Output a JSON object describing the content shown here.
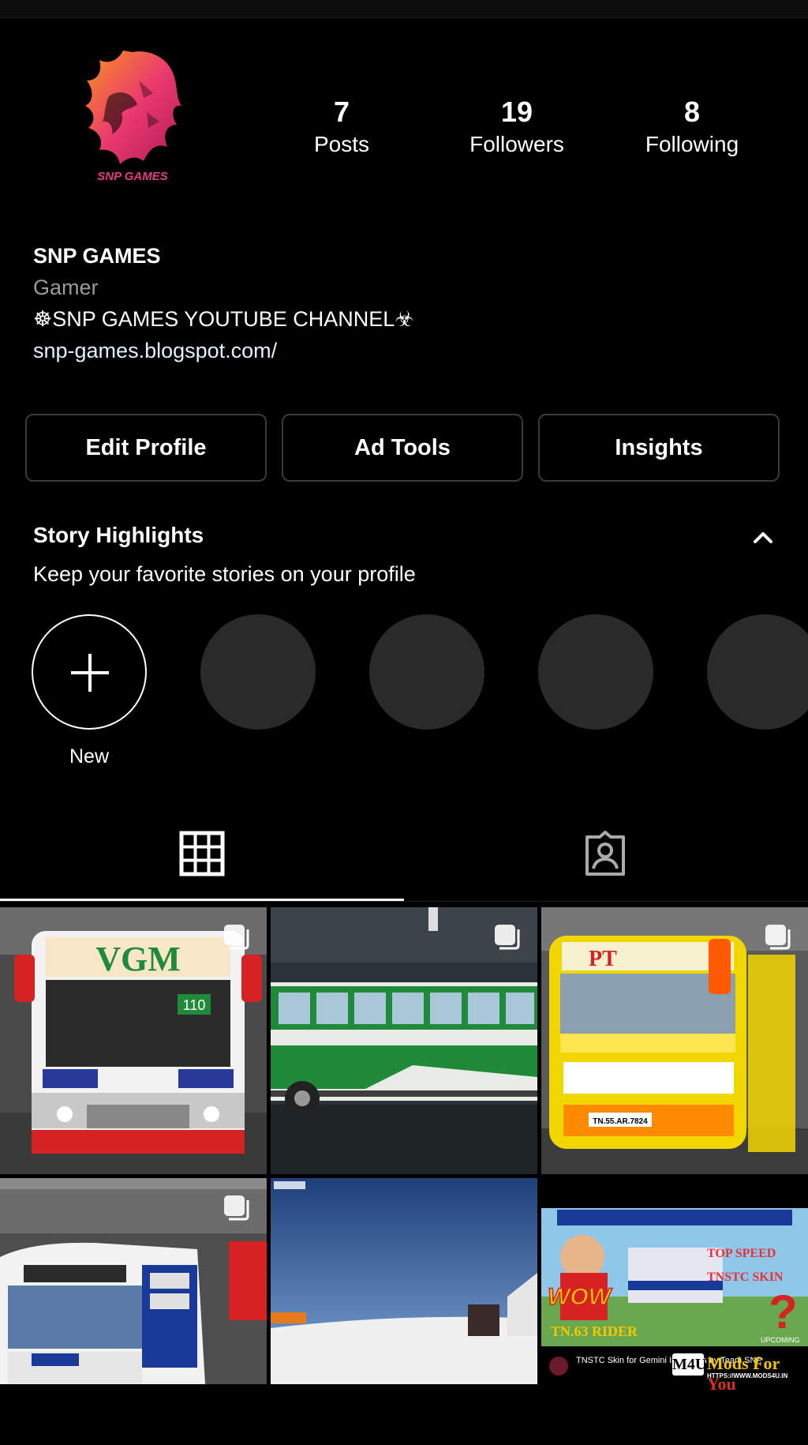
{
  "profile": {
    "avatar_text": "SNP GAMES",
    "stats": [
      {
        "count": "7",
        "label": "Posts"
      },
      {
        "count": "19",
        "label": "Followers"
      },
      {
        "count": "8",
        "label": "Following"
      }
    ],
    "name": "SNP GAMES",
    "category": "Gamer",
    "bio": "☸SNP GAMES YOUTUBE CHANNEL☣",
    "link": "snp-games.blogspot.com/"
  },
  "buttons": {
    "edit": "Edit Profile",
    "ad_tools": "Ad Tools",
    "insights": "Insights"
  },
  "highlights": {
    "title": "Story Highlights",
    "subtitle": "Keep your favorite stories on your profile",
    "new_label": "New"
  },
  "tabs": {
    "posts_icon": "grid-icon",
    "tagged_icon": "tagged-person-icon"
  },
  "posts": {
    "tile1_text": "VGM",
    "tile1_route": "110",
    "tile3_text": "PT",
    "tile3_plate": "TN.55.AR.7824",
    "tile6_wow": "WOW",
    "tile6_rider": "TN.63 RIDER",
    "tile6_speed": "TOP SPEED",
    "tile6_skin": "TNSTC SKIN",
    "tile6_upcoming": "UPCOMING",
    "tile6_caption": "TNSTC Skin for Gemini Indonesia by Team SNP"
  },
  "watermark": {
    "logo": "M4U",
    "brand_a": "Mods For",
    "brand_b": " You",
    "url": "HTTPS://WWW.MODS4U.IN"
  },
  "colors": {
    "accent_lion": "#e8306e",
    "bus_green": "#1f8a3a",
    "bus_yellow": "#f2d600"
  }
}
